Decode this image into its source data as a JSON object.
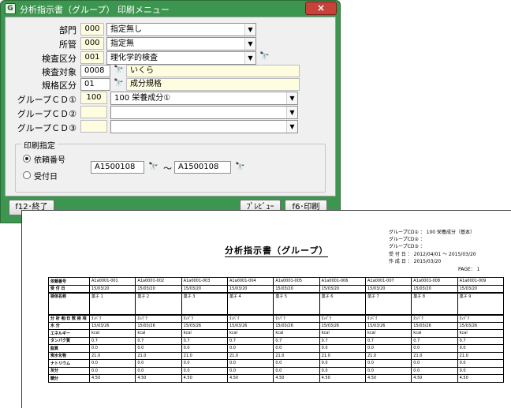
{
  "window": {
    "title": "分析指示書（グループ）  印刷メニュー",
    "app_icon_glyph": "G",
    "close_glyph": "×"
  },
  "form": {
    "dept": {
      "label": "部門",
      "code": "000",
      "value": "指定無し"
    },
    "office": {
      "label": "所管",
      "code": "000",
      "value": "指定無"
    },
    "inspection_type": {
      "label": "検査区分",
      "code": "001",
      "value": "理化学的検査"
    },
    "inspection_target": {
      "label": "検査対象",
      "code": "0008",
      "value": "いくら"
    },
    "standard_type": {
      "label": "規格区分",
      "code": "01",
      "value": "成分規格"
    },
    "group1": {
      "label": "グループＣＤ①",
      "code": "100",
      "value": "100 栄養成分①"
    },
    "group2": {
      "label": "グループＣＤ②",
      "code": "",
      "value": ""
    },
    "group3": {
      "label": "グループＣＤ③",
      "code": "",
      "value": ""
    },
    "combo_arrow": "▼",
    "binoc_glyph": "🔭"
  },
  "print_spec": {
    "title": "印刷指定",
    "option_request": "依頼番号",
    "option_received": "受付日",
    "range_from": "A1500108",
    "range_to": "A1500108",
    "tilde": "～"
  },
  "footer": {
    "exit_label": "f12･終了",
    "preview_label": "ﾌﾟﾚﾋﾞｭｰ",
    "print_label": "f6･印刷"
  },
  "report": {
    "title": "分析指示書（グループ）",
    "meta": [
      "グループCD① ： 100 栄養成分（基本）",
      "グループCD② ：",
      "グループCD③ ：",
      "受 付 日   ： 2012/04/01  ～  2015/03/20",
      "作 成 日   ： 2015/03/20"
    ],
    "page": "PAGE：   1",
    "rows": [
      {
        "head": "依頼番号",
        "cells": [
          "A1a0001-001",
          "A1a0001-002",
          "A1a0001-003",
          "A1a0001-004",
          "A1a0001-005",
          "A1a0001-006",
          "A1a0001-007",
          "A1a0001-008",
          "A1a0001-009"
        ],
        "thick": false
      },
      {
        "head": "受 付 日",
        "cells": [
          "15/03/20",
          "15/03/20",
          "15/03/20",
          "15/03/20",
          "15/03/20",
          "15/03/20",
          "15/03/20",
          "15/03/20",
          "15/03/20"
        ],
        "thick": true
      },
      {
        "head": "検体名称",
        "cells": [
          "菓子 1",
          "菓子 2",
          "菓子 3",
          "菓子 4",
          "菓子 5",
          "菓子 6",
          "菓子 7",
          "菓子 8",
          "菓子 9"
        ],
        "thick": true,
        "tall": true
      },
      {
        "head": "分 析 者/日 数 検 項",
        "cells": [
          "ﾀﾝﾊﾟｸ",
          "ﾀﾝﾊﾟｸ",
          "ﾀﾝﾊﾟｸ",
          "ﾀﾝﾊﾟｸ",
          "ﾀﾝﾊﾟｸ",
          "ﾀﾝﾊﾟｸ",
          "ﾀﾝﾊﾟｸ",
          "ﾀﾝﾊﾟｸ",
          "ﾀﾝﾊﾟｸ"
        ],
        "thick": false
      },
      {
        "head": "水   分",
        "cells": [
          "15/03/26",
          "15/03/26",
          "15/03/26",
          "15/03/26",
          "15/03/26",
          "15/03/26",
          "15/03/26",
          "15/03/26",
          "15/03/26"
        ],
        "thick": false
      },
      {
        "head": "エネルギー",
        "cells": [
          "kcal",
          "kcal",
          "kcal",
          "kcal",
          "kcal",
          "kcal",
          "kcal",
          "kcal",
          "kcal"
        ],
        "thick": false
      },
      {
        "head": "タンパク質",
        "cells": [
          "0.7",
          "0.7",
          "0.7",
          "0.7",
          "0.7",
          "0.7",
          "0.7",
          "0.7",
          "0.7"
        ],
        "thick": false
      },
      {
        "head": "脂質",
        "cells": [
          "0.0",
          "0.0",
          "0.0",
          "0.0",
          "0.0",
          "0.0",
          "0.0",
          "0.0",
          "0.0"
        ],
        "thick": false
      },
      {
        "head": "炭水化物",
        "cells": [
          "21.0",
          "21.0",
          "21.0",
          "21.0",
          "21.0",
          "21.0",
          "21.0",
          "21.0",
          "21.0"
        ],
        "thick": false
      },
      {
        "head": "ナトリウム",
        "cells": [
          "0.0",
          "0.0",
          "0.0",
          "0.0",
          "0.0",
          "0.0",
          "0.0",
          "0.0",
          "0.0"
        ],
        "thick": false
      },
      {
        "head": "灰分",
        "cells": [
          "0.0",
          "0.0",
          "0.0",
          "0.0",
          "0.0",
          "0.0",
          "0.0",
          "0.0",
          "0.0"
        ],
        "thick": false
      },
      {
        "head": "糖分",
        "cells": [
          "4.50",
          "4.50",
          "4.50",
          "4.50",
          "4.50",
          "4.50",
          "4.50",
          "4.50",
          "4.50"
        ],
        "thick": false
      }
    ]
  }
}
